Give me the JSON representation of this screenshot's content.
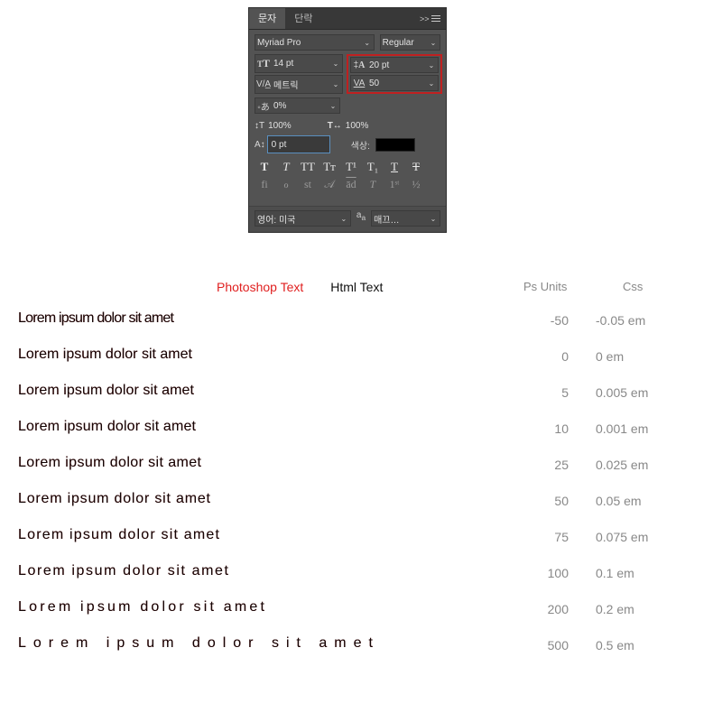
{
  "panel": {
    "tab_active": "문자",
    "tab_inactive": "단락",
    "expand_glyph": ">>",
    "font_family": "Myriad Pro",
    "font_style": "Regular",
    "font_size": "14 pt",
    "leading": "20 pt",
    "kerning": "메트릭",
    "tracking": "50",
    "tsume": "0%",
    "vscale": "100%",
    "hscale": "100%",
    "baseline_shift": "0 pt",
    "color_label": "색상:",
    "lang": "영어: 미국",
    "aa": "매끄…",
    "style": {
      "bold": "T",
      "italic": "T",
      "allcaps": "TT",
      "smallcaps": "Tᴛ",
      "sup": "T¹",
      "sub": "T₁",
      "underline": "T",
      "strike": "T"
    },
    "ot": {
      "liga": "fi",
      "calt": "ℴ",
      "st": "st",
      "swsh": "𝒜",
      "aalt": "ād",
      "titl": "T",
      "ordn": "1ˢᵗ",
      "frac": "½"
    }
  },
  "legend": {
    "ps": "Photoshop Text",
    "html": "Html Text",
    "col_ps": "Ps Units",
    "col_css": "Css"
  },
  "sample_text": "Lorem ipsum dolor sit amet",
  "rows": [
    {
      "ps": "-50",
      "css": "-0.05 em",
      "ls": "-0.05em"
    },
    {
      "ps": "0",
      "css": "0 em",
      "ls": "0em"
    },
    {
      "ps": "5",
      "css": "0.005 em",
      "ls": "0.005em"
    },
    {
      "ps": "10",
      "css": "0.001 em",
      "ls": "0.01em"
    },
    {
      "ps": "25",
      "css": "0.025 em",
      "ls": "0.025em"
    },
    {
      "ps": "50",
      "css": "0.05 em",
      "ls": "0.05em"
    },
    {
      "ps": "75",
      "css": "0.075 em",
      "ls": "0.075em"
    },
    {
      "ps": "100",
      "css": "0.1 em",
      "ls": "0.1em"
    },
    {
      "ps": "200",
      "css": "0.2 em",
      "ls": "0.2em"
    },
    {
      "ps": "500",
      "css": "0.5 em",
      "ls": "0.5em"
    }
  ]
}
